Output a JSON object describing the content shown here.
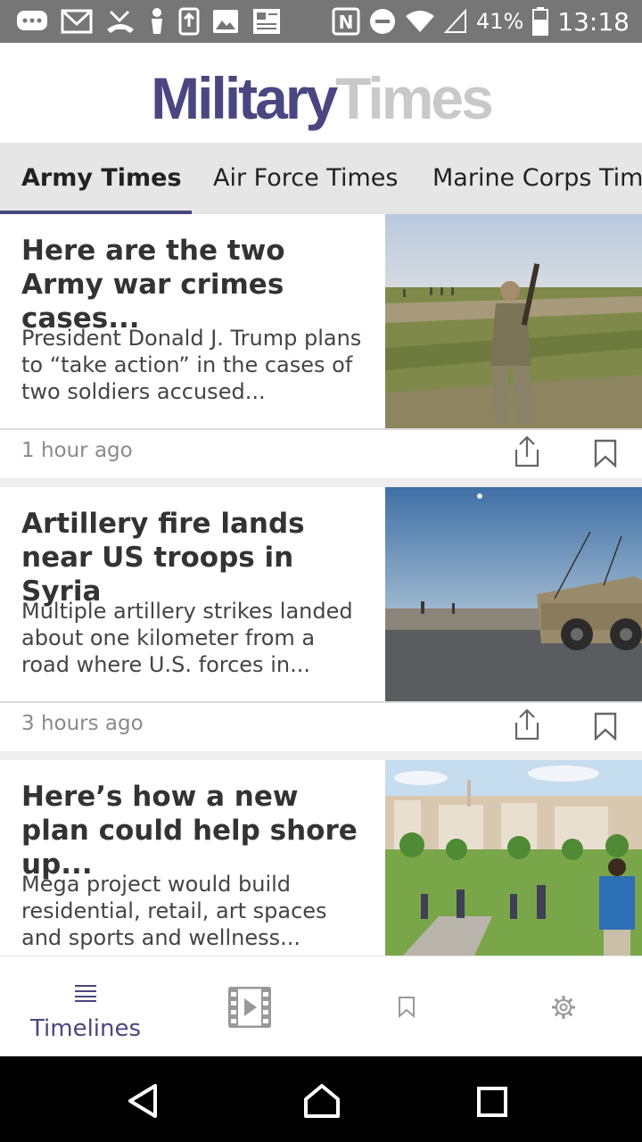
{
  "status_bar": {
    "battery": "41%",
    "time": "13:18"
  },
  "header": {
    "logo_part1": "Military",
    "logo_part2": "Times"
  },
  "tabs": [
    {
      "label": "Army Times",
      "active": true
    },
    {
      "label": "Air Force Times",
      "active": false
    },
    {
      "label": "Marine Corps Times",
      "active": false
    }
  ],
  "articles": [
    {
      "title": "Here are the two Army war crimes cases...",
      "summary": "President Donald J. Trump plans to “take action” in the cases of two soldiers accused...",
      "time": "1 hour ago"
    },
    {
      "title": "Artillery fire lands near US troops in Syria",
      "summary": "Multiple artillery strikes landed about one kilometer from a road where U.S. forces in...",
      "time": "3 hours ago"
    },
    {
      "title": "Here’s how a new plan could help shore up...",
      "summary": "Mega project would build residential, retail, art spaces and sports and wellness...",
      "time": ""
    }
  ],
  "bottom_nav": {
    "timelines_label": "Timelines"
  },
  "colors": {
    "accent": "#4a4780",
    "logo_secondary": "#c9c9c9",
    "status_bar": "#767676"
  },
  "icons": {
    "status_left": [
      "chat-icon",
      "gmail-icon",
      "missed-call-icon",
      "accessibility-icon",
      "upload-icon",
      "image-icon",
      "news-icon"
    ],
    "status_right": [
      "nfc-icon",
      "do-not-disturb-icon",
      "wifi-icon",
      "signal-icon",
      "battery-icon"
    ],
    "article_actions": [
      "share-icon",
      "bookmark-icon"
    ],
    "bottom_nav": [
      "timelines-icon",
      "video-icon",
      "bookmark-icon",
      "gear-icon"
    ],
    "system_nav": [
      "back-icon",
      "home-icon",
      "recents-icon"
    ]
  }
}
